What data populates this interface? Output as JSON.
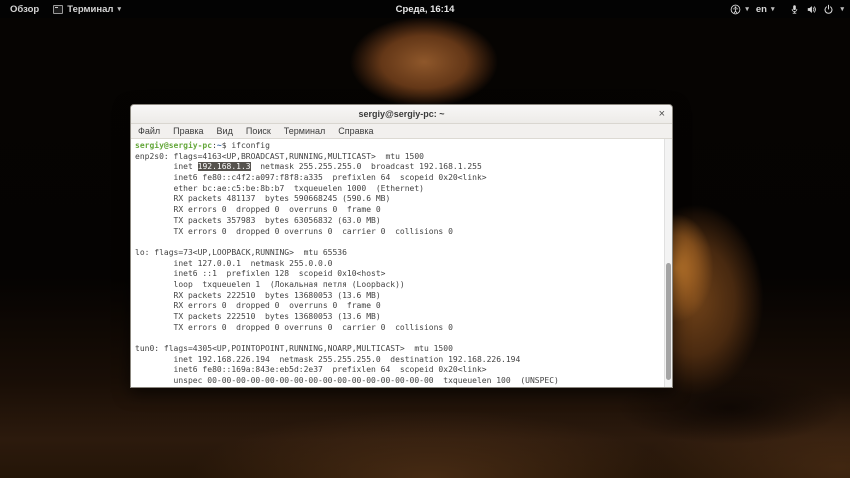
{
  "top_bar": {
    "activities_label": "Обзор",
    "app_menu_label": "Терминал",
    "clock": "Среда, 16:14",
    "language": "en",
    "caret_glyph": "▾",
    "icons": [
      "terminal-app-icon",
      "accessibility-icon",
      "microphone-icon",
      "volume-icon",
      "power-icon"
    ]
  },
  "window": {
    "title": "sergiy@sergiy-pc: ~",
    "close_glyph": "×",
    "menu_items": [
      "Файл",
      "Правка",
      "Вид",
      "Поиск",
      "Терминал",
      "Справка"
    ]
  },
  "terminal": {
    "command": "ifconfig",
    "selected_text": "192.168.1.3",
    "lines": [
      [
        {
          "t": "sergiy@sergiy-pc",
          "c": "green"
        },
        {
          "t": ":"
        },
        {
          "t": "~",
          "c": "blue"
        },
        {
          "t": "$ ifconfig"
        }
      ],
      [
        {
          "t": "enp2s0: flags=4163<UP,BROADCAST,RUNNING,MULTICAST>  mtu 1500"
        }
      ],
      [
        {
          "t": "        inet "
        },
        {
          "t": "192.168.1.3",
          "c": "sel"
        },
        {
          "t": "  netmask 255.255.255.0  broadcast 192.168.1.255"
        }
      ],
      [
        {
          "t": "        inet6 fe80::c4f2:a097:f8f8:a335  prefixlen 64  scopeid 0x20<link>"
        }
      ],
      [
        {
          "t": "        ether bc:ae:c5:be:8b:b7  txqueuelen 1000  (Ethernet)"
        }
      ],
      [
        {
          "t": "        RX packets 481137  bytes 590668245 (590.6 MB)"
        }
      ],
      [
        {
          "t": "        RX errors 0  dropped 0  overruns 0  frame 0"
        }
      ],
      [
        {
          "t": "        TX packets 357983  bytes 63056832 (63.0 MB)"
        }
      ],
      [
        {
          "t": "        TX errors 0  dropped 0 overruns 0  carrier 0  collisions 0"
        }
      ],
      [
        {
          "t": ""
        }
      ],
      [
        {
          "t": "lo: flags=73<UP,LOOPBACK,RUNNING>  mtu 65536"
        }
      ],
      [
        {
          "t": "        inet 127.0.0.1  netmask 255.0.0.0"
        }
      ],
      [
        {
          "t": "        inet6 ::1  prefixlen 128  scopeid 0x10<host>"
        }
      ],
      [
        {
          "t": "        loop  txqueuelen 1  (Локальная петля (Loopback))"
        }
      ],
      [
        {
          "t": "        RX packets 222510  bytes 13680053 (13.6 MB)"
        }
      ],
      [
        {
          "t": "        RX errors 0  dropped 0  overruns 0  frame 0"
        }
      ],
      [
        {
          "t": "        TX packets 222510  bytes 13680053 (13.6 MB)"
        }
      ],
      [
        {
          "t": "        TX errors 0  dropped 0 overruns 0  carrier 0  collisions 0"
        }
      ],
      [
        {
          "t": ""
        }
      ],
      [
        {
          "t": "tun0: flags=4305<UP,POINTOPOINT,RUNNING,NOARP,MULTICAST>  mtu 1500"
        }
      ],
      [
        {
          "t": "        inet 192.168.226.194  netmask 255.255.255.0  destination 192.168.226.194"
        }
      ],
      [
        {
          "t": "        inet6 fe80::169a:843e:eb5d:2e37  prefixlen 64  scopeid 0x20<link>"
        }
      ],
      [
        {
          "t": "        unspec 00-00-00-00-00-00-00-00-00-00-00-00-00-00-00-00  txqueuelen 100  (UNSPEC)"
        }
      ]
    ]
  },
  "colors": {
    "prompt_green": "#64a73a",
    "path_blue": "#3465a4",
    "terminal_text": "#434343",
    "selection_bg": "#56534e",
    "topbar_bg": "#030303",
    "titlebar_bg": "#f2f0ee"
  }
}
